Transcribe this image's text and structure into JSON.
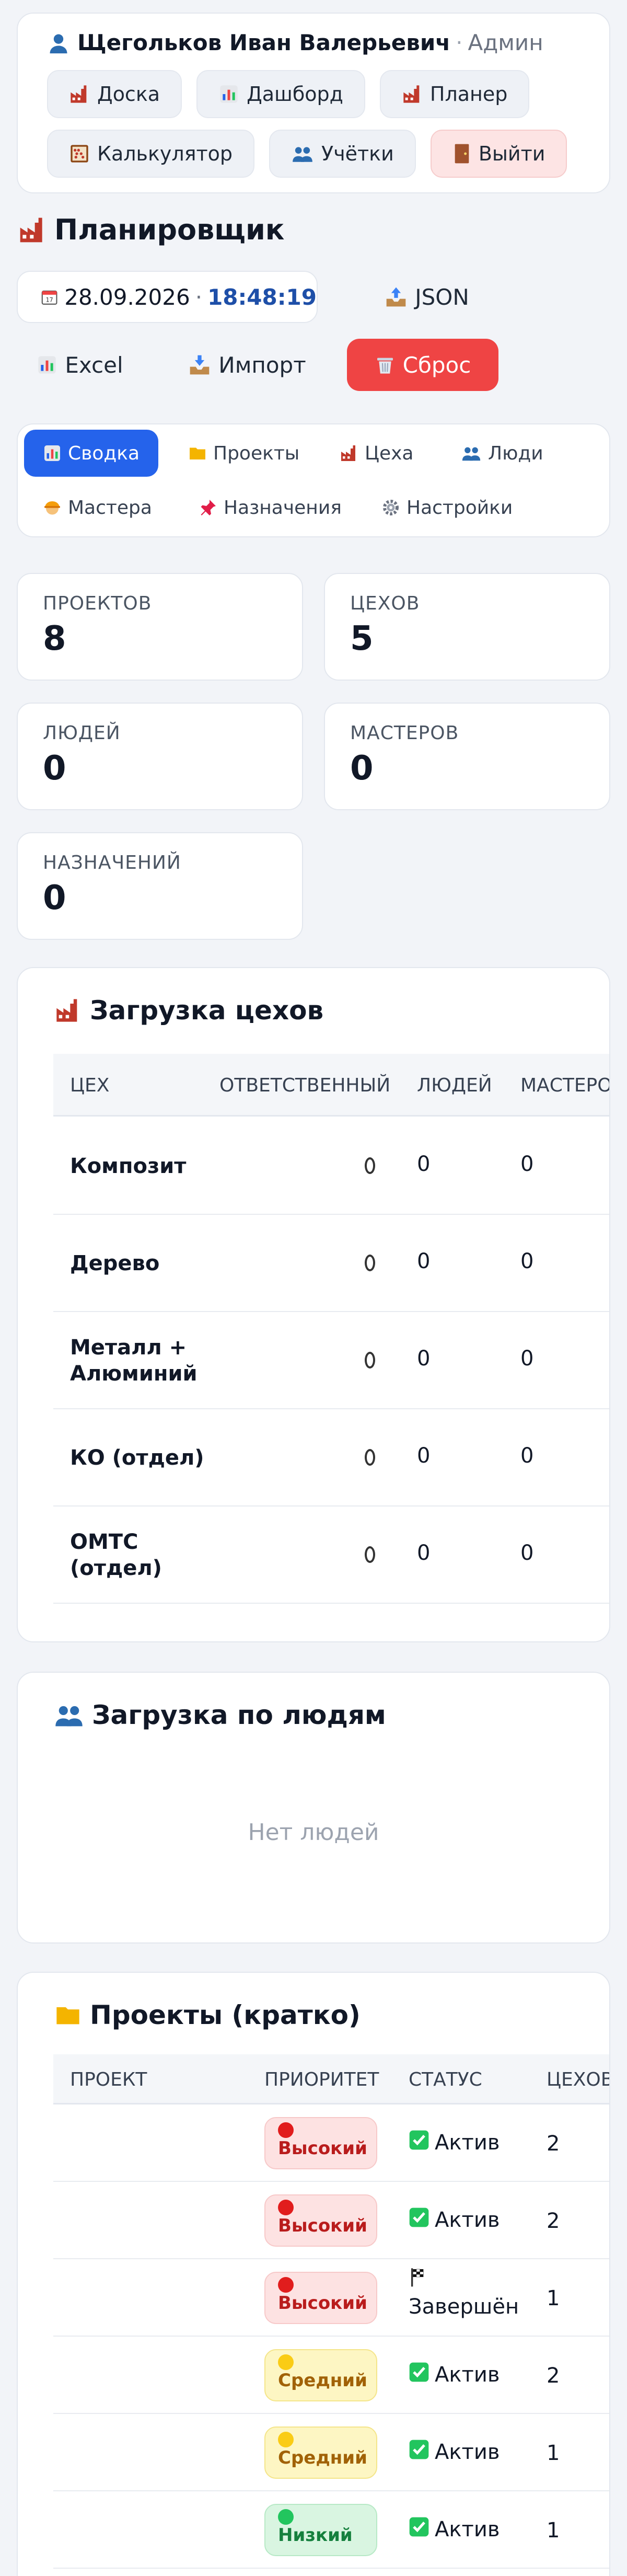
{
  "user": {
    "icon": "user-icon",
    "name": "Щегольков Иван Валерьевич",
    "separator": "·",
    "role": "Админ"
  },
  "nav": {
    "board": {
      "icon": "factory-icon",
      "label": "Доска"
    },
    "dashboard": {
      "icon": "chart-icon",
      "label": "Дашборд"
    },
    "planner": {
      "icon": "factory-icon",
      "label": "Планер"
    },
    "calculator": {
      "icon": "abacus-icon",
      "label": "Калькулятор"
    },
    "accounts": {
      "icon": "users-icon",
      "label": "Учётки"
    },
    "logout": {
      "icon": "door-icon",
      "label": "Выйти"
    }
  },
  "planner": {
    "title": "Планировщик",
    "date": "28.09.2026",
    "date_sep": "·",
    "time": "18:48:19",
    "json_label": "JSON",
    "excel_label": "Excel",
    "import_label": "Импорт",
    "reset_label": "Сброс"
  },
  "tabs": {
    "summary": "Сводка",
    "projects": "Проекты",
    "workshops": "Цеха",
    "people": "Люди",
    "masters": "Мастера",
    "assignments": "Назначения",
    "settings": "Настройки"
  },
  "stats": {
    "projects": {
      "label": "ПРОЕКТОВ",
      "value": "8"
    },
    "workshops": {
      "label": "ЦЕХОВ",
      "value": "5"
    },
    "people": {
      "label": "ЛЮДЕЙ",
      "value": "0"
    },
    "masters": {
      "label": "МАСТЕРОВ",
      "value": "0"
    },
    "assignments": {
      "label": "НАЗНАЧЕНИЙ",
      "value": "0"
    }
  },
  "workshop_load": {
    "title": "Загрузка цехов",
    "headers": {
      "workshop": "ЦЕХ",
      "responsible": "ОТВЕТСТВЕННЫЙ",
      "people": "ЛЮДЕЙ",
      "masters": "МАСТЕРОВ"
    },
    "rows": [
      {
        "name": "Композит",
        "people": "0",
        "masters": "0"
      },
      {
        "name": "Дерево",
        "people": "0",
        "masters": "0"
      },
      {
        "name": "Металл + Алюминий",
        "people": "0",
        "masters": "0"
      },
      {
        "name": "КО (отдел)",
        "people": "0",
        "masters": "0"
      },
      {
        "name": "ОМТС (отдел)",
        "people": "0",
        "masters": "0"
      }
    ]
  },
  "people_load": {
    "title": "Загрузка по людям",
    "empty": "Нет людей"
  },
  "projects_brief": {
    "title": "Проекты (кратко)",
    "headers": {
      "project": "ПРОЕКТ",
      "priority": "ПРИОРИТЕТ",
      "status": "СТАТУС",
      "workshops": "ЦЕХОВ"
    },
    "rows": [
      {
        "priority": "Высокий",
        "level": "high",
        "status_icon": "check-icon",
        "status": "Актив",
        "workshops": "2"
      },
      {
        "priority": "Высокий",
        "level": "high",
        "status_icon": "check-icon",
        "status": "Актив",
        "workshops": "2"
      },
      {
        "priority": "Высокий",
        "level": "high",
        "status_icon": "flag-icon",
        "status": "Завершён",
        "workshops": "1"
      },
      {
        "priority": "Средний",
        "level": "mid",
        "status_icon": "check-icon",
        "status": "Актив",
        "workshops": "2"
      },
      {
        "priority": "Средний",
        "level": "mid",
        "status_icon": "check-icon",
        "status": "Актив",
        "workshops": "1"
      },
      {
        "priority": "Низкий",
        "level": "low",
        "status_icon": "check-icon",
        "status": "Актив",
        "workshops": "1"
      }
    ]
  }
}
